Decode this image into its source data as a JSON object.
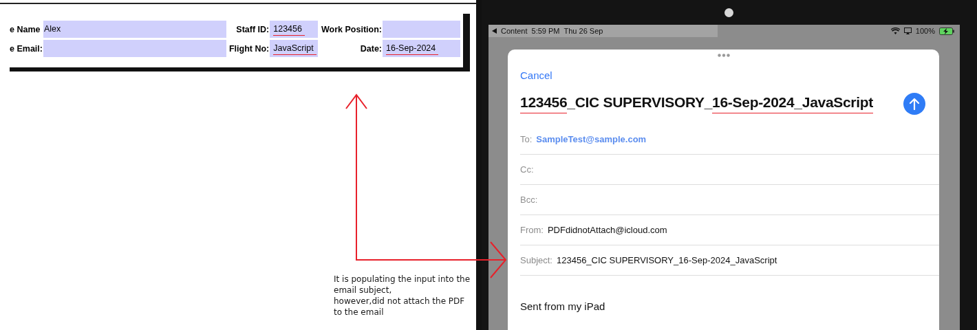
{
  "pdf_form": {
    "rows": [
      [
        {
          "label": "e Name",
          "value": "Alex",
          "annotated": false
        },
        {
          "label": "Staff ID:",
          "value": "123456",
          "annotated": true
        },
        {
          "label": "Work Position:",
          "annotated": false
        }
      ],
      [
        {
          "label": "e Email:",
          "annotated": false
        },
        {
          "label": "Flight No:",
          "value": "JavaScript",
          "annotated": true
        },
        {
          "label": "Date:",
          "value": "16-Sep-2024",
          "annotated": true
        }
      ]
    ]
  },
  "annotation": {
    "text": "It is populating the input into the email subject,\nhowever,did not attach the PDF to the email"
  },
  "status_bar": {
    "back": "Content",
    "time": "5:59 PM",
    "date": "Thu 26 Sep",
    "battery": "100%"
  },
  "compose": {
    "cancel": "Cancel",
    "title": [
      {
        "text": "123456",
        "annotated": true
      },
      {
        "text": "_CIC SUPERVISORY_",
        "annotated": false
      },
      {
        "text": "16-Sep-2024_",
        "annotated": true
      },
      {
        "text": "JavaScript",
        "annotated": true
      }
    ],
    "fields": [
      {
        "label": "To:",
        "value": "SampleTest@sample.com",
        "kind": "recipient"
      },
      {
        "label": "Cc:",
        "kind": "recipient"
      },
      {
        "label": "Bcc:",
        "kind": "recipient"
      },
      {
        "label": "From:",
        "value": "PDFdidnotAttach@icloud.com",
        "kind": "sender"
      },
      {
        "label": "Subject:",
        "value": "123456_CIC SUPERVISORY_16-Sep-2024_JavaScript",
        "kind": "subject"
      }
    ],
    "body": "Sent from my iPad"
  }
}
